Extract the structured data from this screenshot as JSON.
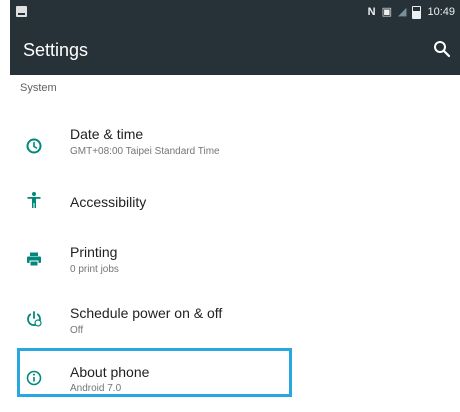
{
  "status_bar": {
    "time": "10:49"
  },
  "app_bar": {
    "title": "Settings",
    "search_icon": "search-icon"
  },
  "section": {
    "header": "System"
  },
  "items": [
    {
      "title": "Date & time",
      "summary": "GMT+08:00 Taipei Standard Time",
      "icon": "clock-icon"
    },
    {
      "title": "Accessibility",
      "summary": "",
      "icon": "accessibility-icon"
    },
    {
      "title": "Printing",
      "summary": "0 print jobs",
      "icon": "printer-icon"
    },
    {
      "title": "Schedule power on & off",
      "summary": "Off",
      "icon": "power-schedule-icon"
    },
    {
      "title": "About phone",
      "summary": "Android 7.0",
      "icon": "info-icon"
    }
  ],
  "colors": {
    "app_bar": "#263238",
    "accent": "#00897b",
    "highlight": "#29a7e1"
  }
}
